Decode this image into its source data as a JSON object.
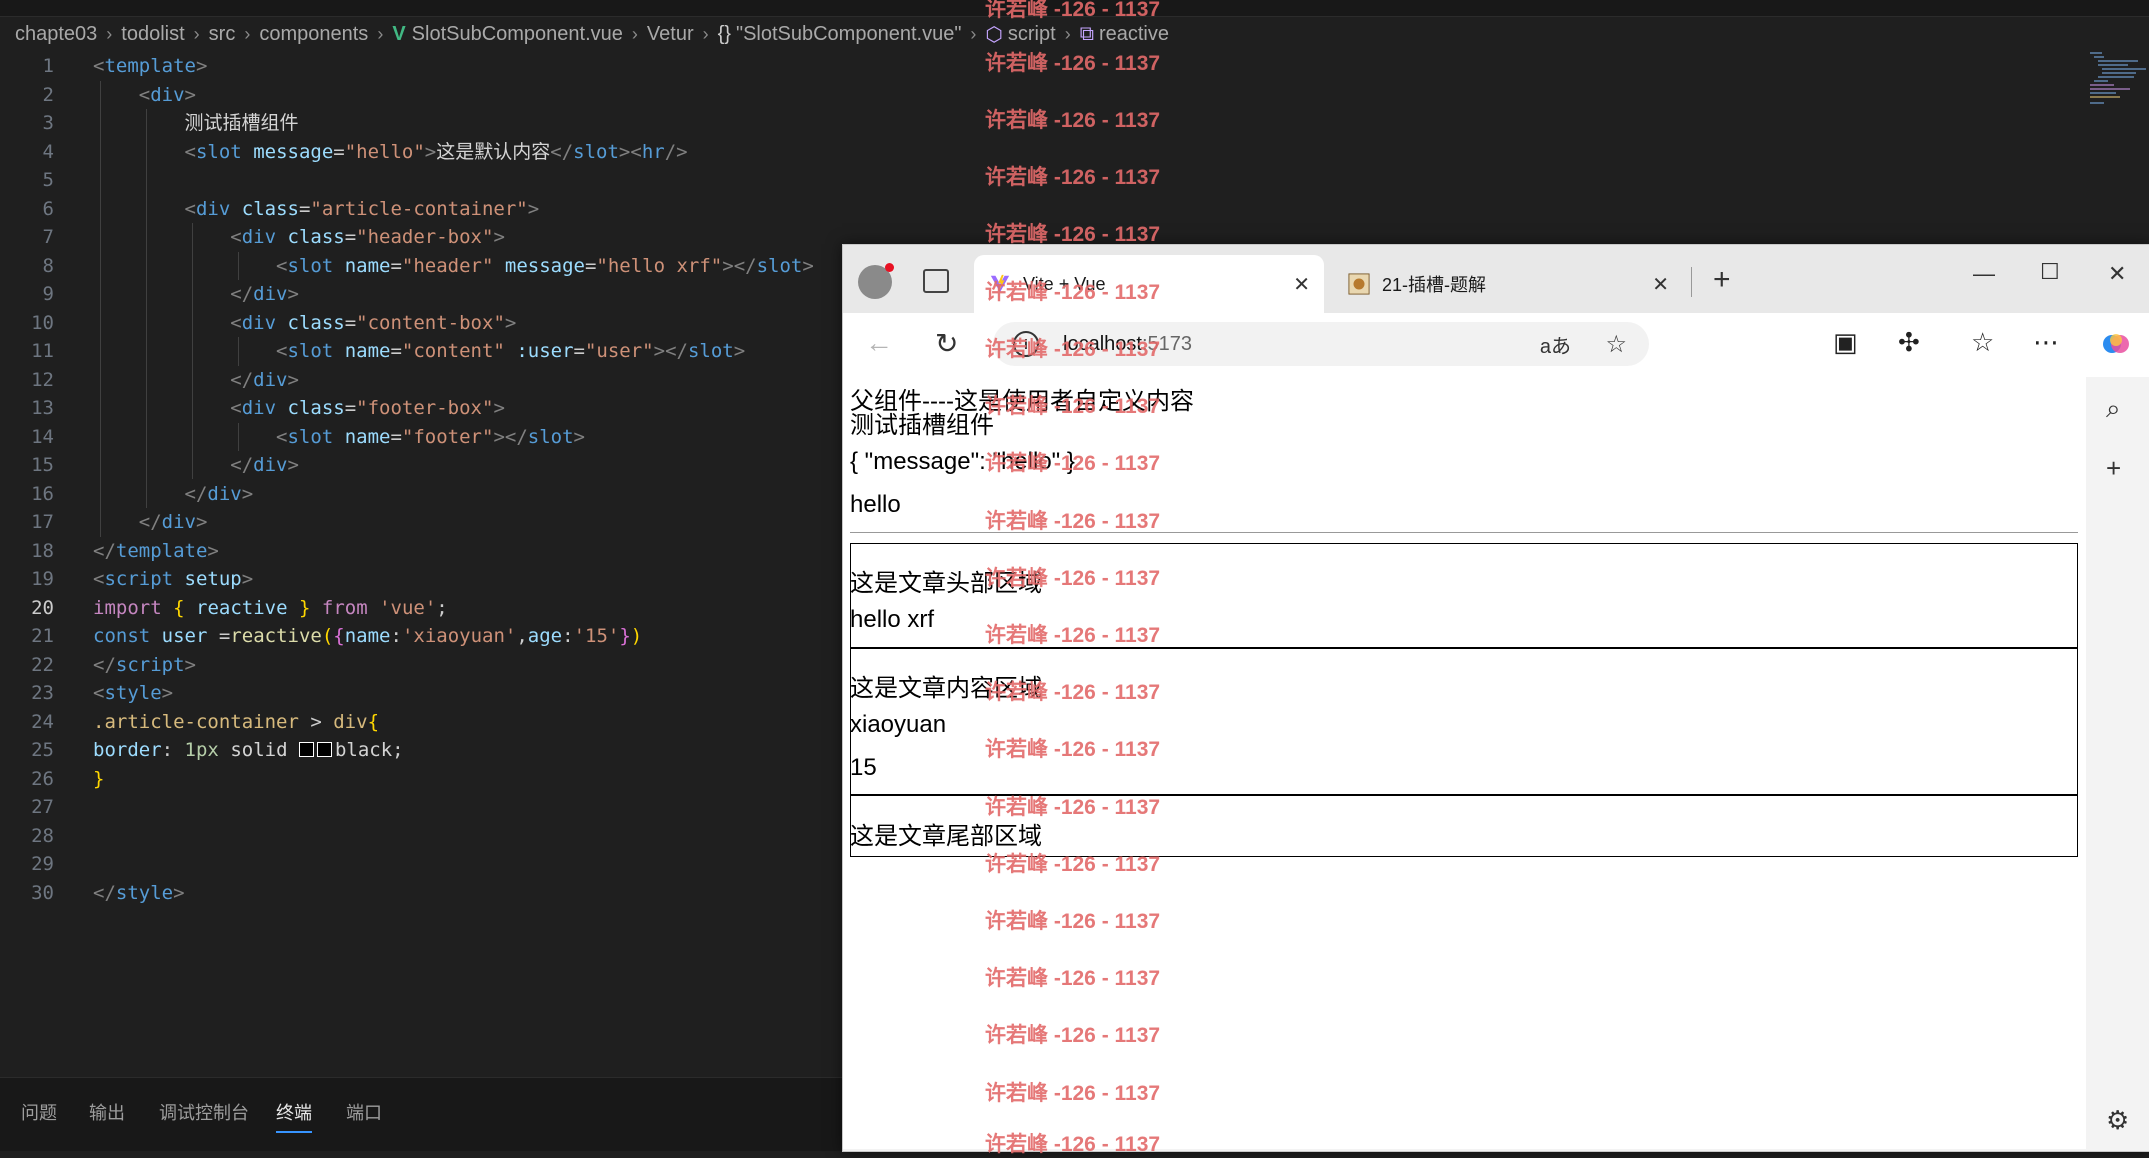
{
  "breadcrumb": {
    "items": [
      "chapte03",
      "todolist",
      "src",
      "components",
      "SlotSubComponent.vue",
      "Vetur",
      "\"SlotSubComponent.vue\"",
      "script",
      "reactive"
    ],
    "vue_glyph": "V",
    "braces_glyph": "{}"
  },
  "editor": {
    "current_line": 20,
    "line_numbers": [
      "1",
      "2",
      "3",
      "4",
      "5",
      "6",
      "7",
      "8",
      "9",
      "10",
      "11",
      "12",
      "13",
      "14",
      "15",
      "16",
      "17",
      "18",
      "19",
      "20",
      "21",
      "22",
      "23",
      "24",
      "25",
      "26",
      "27",
      "28",
      "29",
      "30"
    ]
  },
  "panel": {
    "tabs": [
      "问题",
      "输出",
      "调试控制台",
      "终端",
      "端口"
    ],
    "active": "终端"
  },
  "browser": {
    "tabs": [
      {
        "title": "Vite + Vue",
        "active": true
      },
      {
        "title": "21-插槽-题解",
        "active": false
      }
    ],
    "address_host": "localhost",
    "address_port": ":5173",
    "read_aloud": "aあ"
  },
  "page": {
    "line1": "父组件----这是使用者自定义内容",
    "line2": "测试插槽组件",
    "slot_props": "{ \"message\": \"hello\" }",
    "message": "hello",
    "header_title": "这是文章头部区域",
    "header_msg": "hello xrf",
    "content_title": "这是文章内容区域",
    "user_name": "xiaoyuan",
    "user_age": "15",
    "footer_title": "这是文章尾部区域"
  },
  "watermark": "许若峰 -126 - 1137",
  "colors": {
    "editor_bg": "#1f1f1f",
    "watermark": "#e36a6a",
    "active_tab_accent": "#3794ff"
  }
}
